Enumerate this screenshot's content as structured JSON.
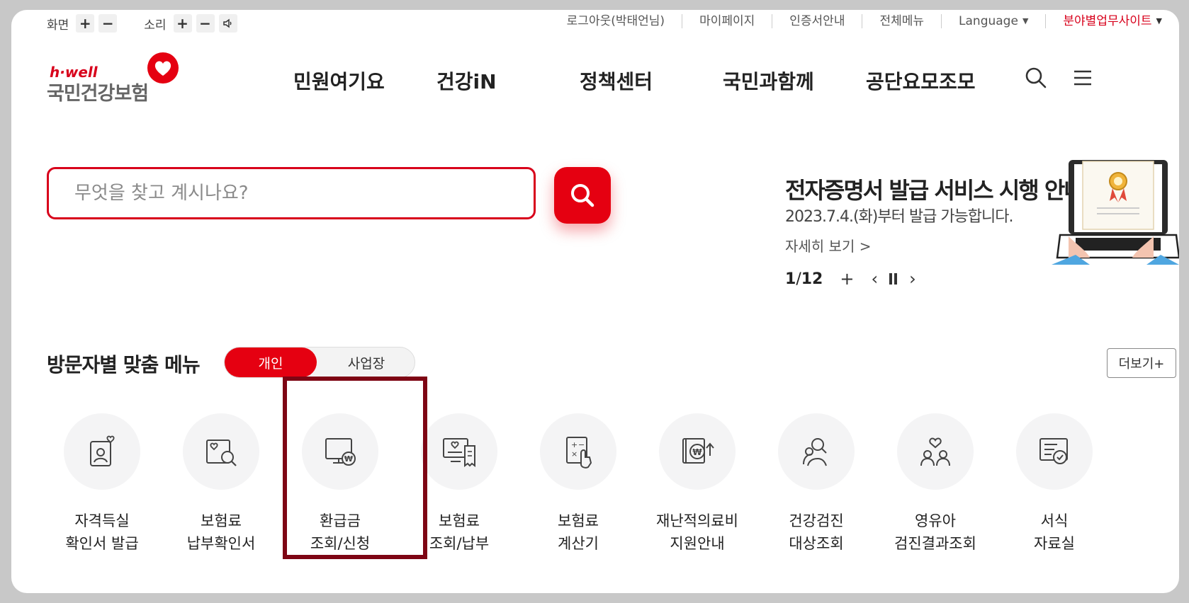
{
  "util": {
    "screen_label": "화면",
    "sound_label": "소리",
    "plus": "+",
    "minus": "−",
    "links": [
      "로그아웃(박태언님)",
      "마이페이지",
      "인증서안내",
      "전체메뉴"
    ],
    "language": "Language",
    "field_site": "분야별업무사이트"
  },
  "logo": {
    "small": "h·well",
    "name": "국민건강보험"
  },
  "gnb": [
    "민원여기요",
    "건강iN",
    "정책센터",
    "국민과함께",
    "공단요모조모"
  ],
  "search": {
    "placeholder": "무엇을 찾고 계시나요?"
  },
  "banner": {
    "title": "전자증명서 발급 서비스 시행 안내",
    "subtitle": "2023.7.4.(화)부터 발급 가능합니다.",
    "more": "자세히 보기 >",
    "page_current": "1",
    "page_total": "12",
    "page_sep": " / "
  },
  "visitor_menu": {
    "title": "방문자별 맞춤 메뉴",
    "tab_personal": "개인",
    "tab_business": "사업장",
    "more": "더보기+",
    "items": [
      {
        "l1": "자격득실",
        "l2": "확인서 발급",
        "icon": "id-card-icon"
      },
      {
        "l1": "보험료",
        "l2": "납부확인서",
        "icon": "search-document-icon"
      },
      {
        "l1": "환급금",
        "l2": "조회/신청",
        "icon": "monitor-won-icon"
      },
      {
        "l1": "보험료",
        "l2": "조회/납부",
        "icon": "monitor-receipt-icon"
      },
      {
        "l1": "보험료",
        "l2": "계산기",
        "icon": "calculator-icon"
      },
      {
        "l1": "재난적의료비",
        "l2": "지원안내",
        "icon": "won-upload-icon"
      },
      {
        "l1": "건강검진",
        "l2": "대상조회",
        "icon": "people-search-icon"
      },
      {
        "l1": "영유아",
        "l2": "검진결과조회",
        "icon": "family-heart-icon"
      },
      {
        "l1": "서식",
        "l2": "자료실",
        "icon": "form-document-icon"
      }
    ]
  },
  "colors": {
    "accent": "#e50011",
    "highlight": "#7e0514"
  }
}
